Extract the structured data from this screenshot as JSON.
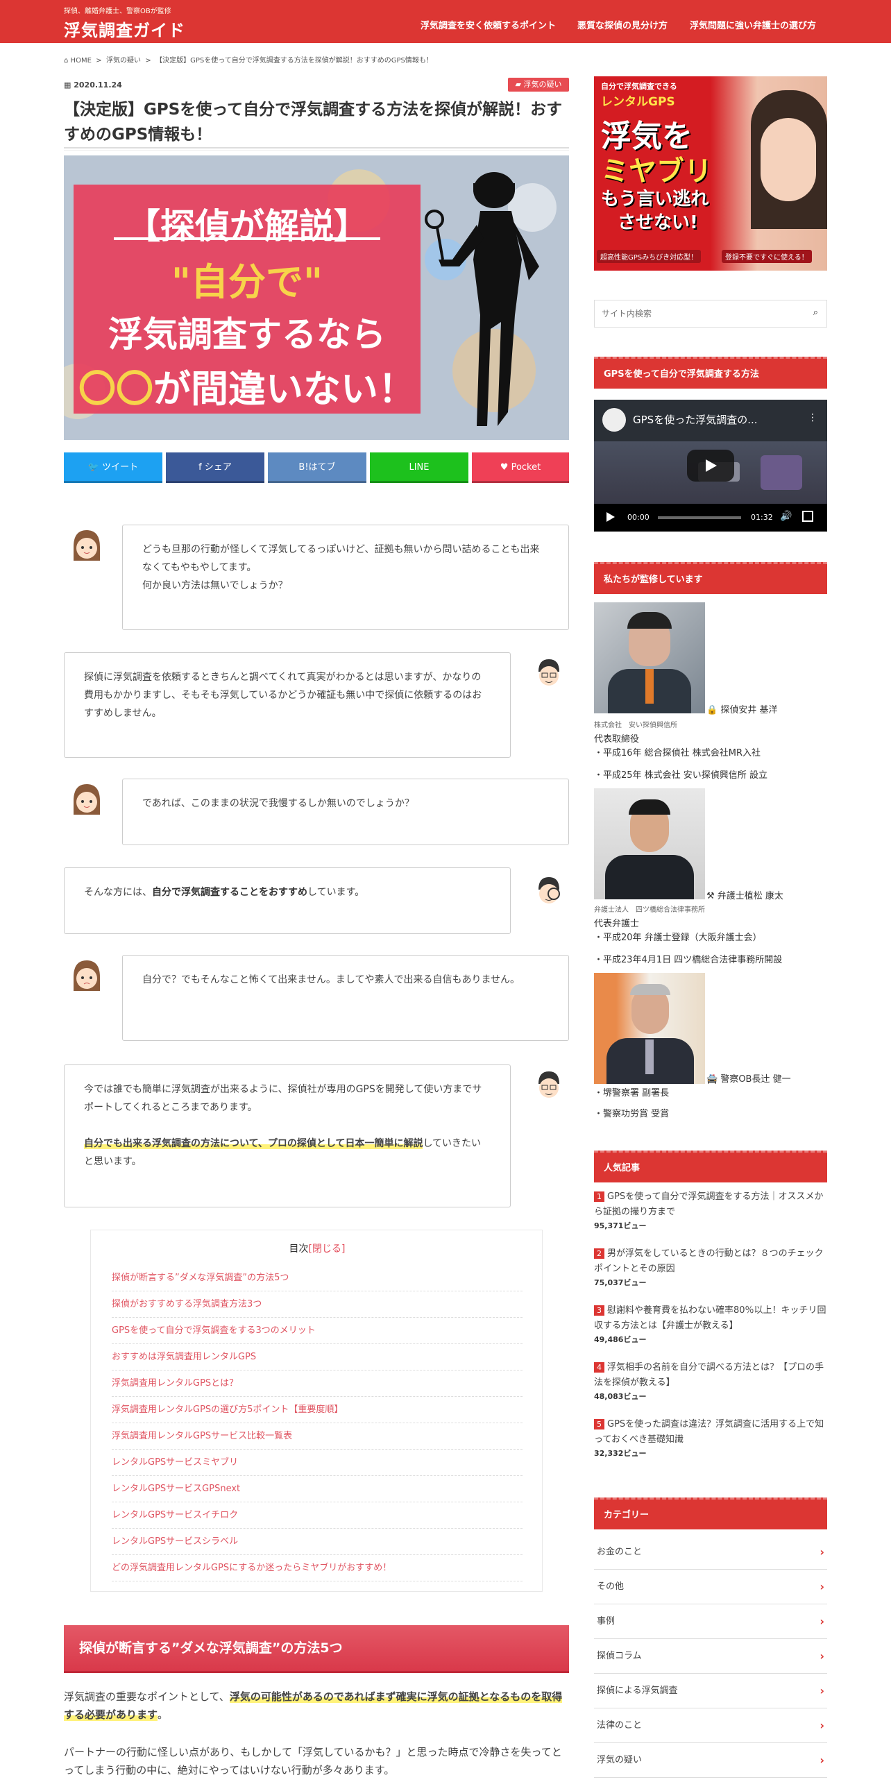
{
  "header": {
    "tagline": "探偵、離婚弁護士、警察OBが監修",
    "logo": "浮気調査ガイド",
    "nav": [
      "浮気調査を安く依頼するポイント",
      "悪質な探偵の見分け方",
      "浮気問題に強い弁護士の選び方"
    ]
  },
  "breadcrumb": {
    "home": "HOME",
    "sep": ">",
    "cat": "浮気の疑い",
    "current": "【決定版】GPSを使って自分で浮気調査する方法を探偵が解説！おすすめのGPS情報も！"
  },
  "article": {
    "date": "2020.11.24",
    "category": "浮気の疑い",
    "title": "【決定版】GPSを使って自分で浮気調査する方法を探偵が解説！おすすめのGPS情報も！",
    "eyecatch": {
      "line1": "【探偵が解説】",
      "line2": "\"自分で\"",
      "line3": "浮気調査するなら",
      "line4a": "〇〇",
      "line4b": "が間違いない！"
    }
  },
  "share": [
    {
      "label": "ツイート",
      "color": "#1da1f2",
      "icon": "twitter-icon"
    },
    {
      "label": "シェア",
      "color": "#3b5998",
      "icon": "facebook-icon"
    },
    {
      "label": "B!はてブ",
      "color": "#5d8ac1",
      "icon": "hatena-icon"
    },
    {
      "label": "LINE",
      "color": "#1dc11d",
      "icon": "line-icon"
    },
    {
      "label": "Pocket",
      "color": "#ef4056",
      "icon": "pocket-icon"
    }
  ],
  "chat": {
    "m1": "どうも旦那の行動が怪しくて浮気してるっぽいけど、証拠も無いから問い詰めることも出来なくてもやもやしてます。",
    "m1b": "何か良い方法は無いでしょうか？",
    "m2": "探偵に浮気調査を依頼するときちんと調べてくれて真実がわかるとは思いますが、かなりの費用もかかりますし、そもそも浮気しているかどうか確証も無い中で探偵に依頼するのはおすすめしません。",
    "m3": "であれば、このままの状況で我慢するしか無いのでしょうか？",
    "m4a": "そんな方には、",
    "m4b": "自分で浮気調査することをおすすめ",
    "m4c": "しています。",
    "m5": "自分で？でもそんなこと怖くて出来ません。ましてや素人で出来る自信もありません。",
    "m6": "今では誰でも簡単に浮気調査が出来るように、探偵社が専用のGPSを開発して使い方までサポートしてくれるところまであります。",
    "m6hl": "自分でも出来る浮気調査の方法について、プロの探偵として日本一簡単に解説",
    "m6c": "していきたいと思います。"
  },
  "toc": {
    "title": "目次",
    "toggle": "[閉じる]",
    "items": [
      "探偵が断言する”ダメな浮気調査”の方法5つ",
      "探偵がおすすめする浮気調査方法3つ",
      "GPSを使って自分で浮気調査をする3つのメリット",
      "おすすめは浮気調査用レンタルGPS",
      "浮気調査用レンタルGPSとは？",
      "浮気調査用レンタルGPSの選び方5ポイント【重要度順】",
      "浮気調査用レンタルGPSサービス比較一覧表",
      "レンタルGPSサービスミヤブリ",
      "レンタルGPSサービスGPSnext",
      "レンタルGPSサービスイチロク",
      "レンタルGPSサービスシラベル",
      "どの浮気調査用レンタルGPSにするか迷ったらミヤブリがおすすめ！"
    ]
  },
  "section1": {
    "heading": "探偵が断言する”ダメな浮気調査”の方法5つ",
    "p1a": "浮気調査の重要なポイントとして、",
    "p1hl": "浮気の可能性があるのであればまず確実に浮気の証拠となるものを取得する必要があります",
    "p1c": "。",
    "p2": "パートナーの行動に怪しい点があり、もしかして「浮気しているかも？」と思った時点で冷静さを失ってとってしまう行動の中に、絶対にやってはいけない行動が多々あります。"
  },
  "sidebar": {
    "ad": {
      "top": "自分で浮気調査できる",
      "gps": "レンタルGPS",
      "big1": "浮気を",
      "big2": "ミヤブリ",
      "big3": "もう言い逃れ",
      "big4": "させない!",
      "foot1": "超高性能GPSみちびき対応型！",
      "foot2": "登録不要ですぐに使える！"
    },
    "search_placeholder": "サイト内検索",
    "video_heading": "GPSを使って自分で浮気調査する方法",
    "video": {
      "title": "GPSを使った浮気調査の...",
      "current": "00:00",
      "duration": "01:32"
    },
    "supervisors_heading": "私たちが監修しています",
    "supervisors": [
      {
        "name": "探偵安井 基洋",
        "org": "株式会社　安い探偵興信所",
        "role": "代表取締役",
        "lines": [
          "・平成16年 総合探偵社 株式会社MR入社",
          "・平成25年 株式会社 安い探偵興信所 設立"
        ]
      },
      {
        "name": "弁護士植松 康太",
        "org": "弁護士法人　四ツ橋総合法律事務所",
        "role": "代表弁護士",
        "lines": [
          "・平成20年 弁護士登録（大阪弁護士会）",
          "・平成23年4月1日 四ツ橋総合法律事務所開設"
        ]
      },
      {
        "name": "警察OB長辻 健一",
        "org": "",
        "role": "",
        "lines": [
          "・堺警察署 副署長",
          "・警察功労賞 受賞"
        ]
      }
    ],
    "popular_heading": "人気記事",
    "popular": [
      {
        "rank": "1",
        "title": "GPSを使って自分で浮気調査をする方法｜オススメから証拠の撮り方まで",
        "views": "95,371ビュー"
      },
      {
        "rank": "2",
        "title": "男が浮気をしているときの行動とは？８つのチェックポイントとその原因",
        "views": "75,037ビュー"
      },
      {
        "rank": "3",
        "title": "慰謝料や養育費を払わない確率80％以上！キッチリ回収する方法とは【弁護士が教える】",
        "views": "49,486ビュー"
      },
      {
        "rank": "4",
        "title": "浮気相手の名前を自分で調べる方法とは？【プロの手法を探偵が教える】",
        "views": "48,083ビュー"
      },
      {
        "rank": "5",
        "title": "GPSを使った調査は違法？浮気調査に活用する上で知っておくべき基礎知識",
        "views": "32,332ビュー"
      }
    ],
    "category_heading": "カテゴリー",
    "categories": [
      "お金のこと",
      "その他",
      "事例",
      "探偵コラム",
      "探偵による浮気調査",
      "法律のこと",
      "浮気の疑い"
    ]
  }
}
